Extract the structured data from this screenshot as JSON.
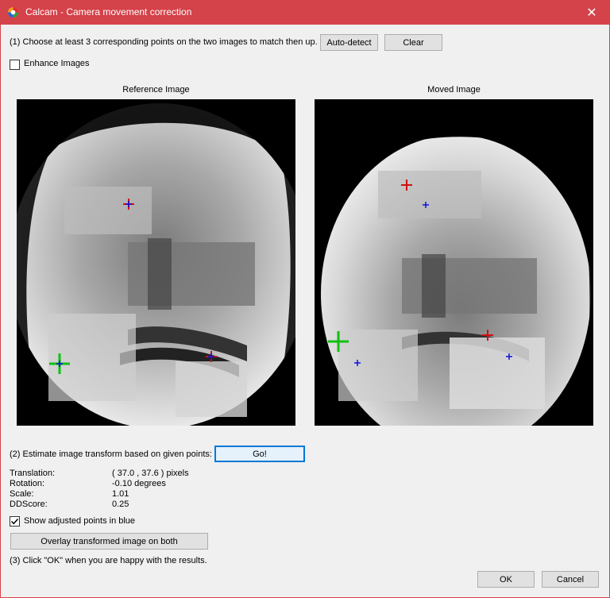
{
  "window": {
    "title": "Calcam - Camera movement correction",
    "close_glyph": "✕",
    "app_icon": "calcam-app-icon"
  },
  "step1": {
    "instruction": "(1) Choose at least 3 corresponding points on the two images to match then up.",
    "autodetect_label": "Auto-detect",
    "clear_label": "Clear",
    "enhance_label": "Enhance Images",
    "enhance_checked": false
  },
  "images": {
    "reference_title": "Reference Image",
    "moved_title": "Moved Image"
  },
  "step2": {
    "instruction": "(2) Estimate image transform based on given points:",
    "go_label": "Go!",
    "results": [
      {
        "label": "Translation:",
        "value": "( 37.0 , 37.6 ) pixels"
      },
      {
        "label": "Rotation:",
        "value": "-0.10 degrees"
      },
      {
        "label": "Scale:",
        "value": "1.01"
      },
      {
        "label": "DDScore:",
        "value": "0.25"
      }
    ],
    "show_adjusted_label": "Show adjusted points in blue",
    "show_adjusted_checked": true,
    "overlay_label": "Overlay transformed image on both"
  },
  "step3": {
    "instruction": "(3) Click \"OK\" when you are happy with the results."
  },
  "footer": {
    "ok_label": "OK",
    "cancel_label": "Cancel"
  },
  "colors": {
    "titlebar": "#d4424a",
    "marker_red": "#d01010",
    "marker_green": "#10c010",
    "marker_blue": "#1010e0"
  }
}
